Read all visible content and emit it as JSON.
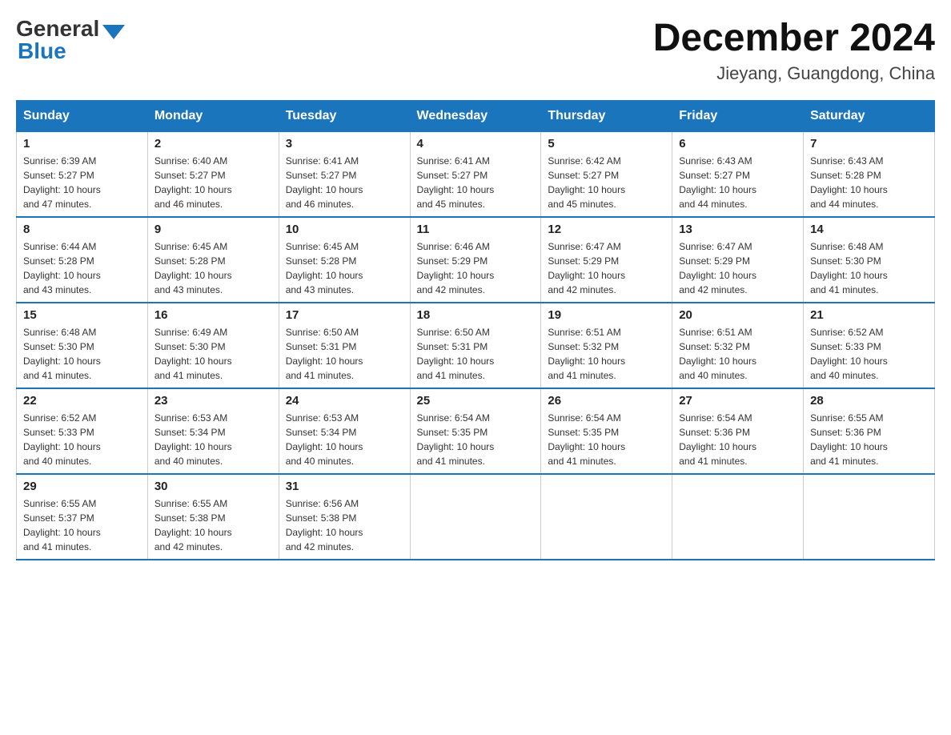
{
  "header": {
    "logo_general": "General",
    "logo_blue": "Blue",
    "month_year": "December 2024",
    "location": "Jieyang, Guangdong, China"
  },
  "days_of_week": [
    "Sunday",
    "Monday",
    "Tuesday",
    "Wednesday",
    "Thursday",
    "Friday",
    "Saturday"
  ],
  "weeks": [
    [
      {
        "day": "1",
        "sunrise": "6:39 AM",
        "sunset": "5:27 PM",
        "daylight": "10 hours and 47 minutes."
      },
      {
        "day": "2",
        "sunrise": "6:40 AM",
        "sunset": "5:27 PM",
        "daylight": "10 hours and 46 minutes."
      },
      {
        "day": "3",
        "sunrise": "6:41 AM",
        "sunset": "5:27 PM",
        "daylight": "10 hours and 46 minutes."
      },
      {
        "day": "4",
        "sunrise": "6:41 AM",
        "sunset": "5:27 PM",
        "daylight": "10 hours and 45 minutes."
      },
      {
        "day": "5",
        "sunrise": "6:42 AM",
        "sunset": "5:27 PM",
        "daylight": "10 hours and 45 minutes."
      },
      {
        "day": "6",
        "sunrise": "6:43 AM",
        "sunset": "5:27 PM",
        "daylight": "10 hours and 44 minutes."
      },
      {
        "day": "7",
        "sunrise": "6:43 AM",
        "sunset": "5:28 PM",
        "daylight": "10 hours and 44 minutes."
      }
    ],
    [
      {
        "day": "8",
        "sunrise": "6:44 AM",
        "sunset": "5:28 PM",
        "daylight": "10 hours and 43 minutes."
      },
      {
        "day": "9",
        "sunrise": "6:45 AM",
        "sunset": "5:28 PM",
        "daylight": "10 hours and 43 minutes."
      },
      {
        "day": "10",
        "sunrise": "6:45 AM",
        "sunset": "5:28 PM",
        "daylight": "10 hours and 43 minutes."
      },
      {
        "day": "11",
        "sunrise": "6:46 AM",
        "sunset": "5:29 PM",
        "daylight": "10 hours and 42 minutes."
      },
      {
        "day": "12",
        "sunrise": "6:47 AM",
        "sunset": "5:29 PM",
        "daylight": "10 hours and 42 minutes."
      },
      {
        "day": "13",
        "sunrise": "6:47 AM",
        "sunset": "5:29 PM",
        "daylight": "10 hours and 42 minutes."
      },
      {
        "day": "14",
        "sunrise": "6:48 AM",
        "sunset": "5:30 PM",
        "daylight": "10 hours and 41 minutes."
      }
    ],
    [
      {
        "day": "15",
        "sunrise": "6:48 AM",
        "sunset": "5:30 PM",
        "daylight": "10 hours and 41 minutes."
      },
      {
        "day": "16",
        "sunrise": "6:49 AM",
        "sunset": "5:30 PM",
        "daylight": "10 hours and 41 minutes."
      },
      {
        "day": "17",
        "sunrise": "6:50 AM",
        "sunset": "5:31 PM",
        "daylight": "10 hours and 41 minutes."
      },
      {
        "day": "18",
        "sunrise": "6:50 AM",
        "sunset": "5:31 PM",
        "daylight": "10 hours and 41 minutes."
      },
      {
        "day": "19",
        "sunrise": "6:51 AM",
        "sunset": "5:32 PM",
        "daylight": "10 hours and 41 minutes."
      },
      {
        "day": "20",
        "sunrise": "6:51 AM",
        "sunset": "5:32 PM",
        "daylight": "10 hours and 40 minutes."
      },
      {
        "day": "21",
        "sunrise": "6:52 AM",
        "sunset": "5:33 PM",
        "daylight": "10 hours and 40 minutes."
      }
    ],
    [
      {
        "day": "22",
        "sunrise": "6:52 AM",
        "sunset": "5:33 PM",
        "daylight": "10 hours and 40 minutes."
      },
      {
        "day": "23",
        "sunrise": "6:53 AM",
        "sunset": "5:34 PM",
        "daylight": "10 hours and 40 minutes."
      },
      {
        "day": "24",
        "sunrise": "6:53 AM",
        "sunset": "5:34 PM",
        "daylight": "10 hours and 40 minutes."
      },
      {
        "day": "25",
        "sunrise": "6:54 AM",
        "sunset": "5:35 PM",
        "daylight": "10 hours and 41 minutes."
      },
      {
        "day": "26",
        "sunrise": "6:54 AM",
        "sunset": "5:35 PM",
        "daylight": "10 hours and 41 minutes."
      },
      {
        "day": "27",
        "sunrise": "6:54 AM",
        "sunset": "5:36 PM",
        "daylight": "10 hours and 41 minutes."
      },
      {
        "day": "28",
        "sunrise": "6:55 AM",
        "sunset": "5:36 PM",
        "daylight": "10 hours and 41 minutes."
      }
    ],
    [
      {
        "day": "29",
        "sunrise": "6:55 AM",
        "sunset": "5:37 PM",
        "daylight": "10 hours and 41 minutes."
      },
      {
        "day": "30",
        "sunrise": "6:55 AM",
        "sunset": "5:38 PM",
        "daylight": "10 hours and 42 minutes."
      },
      {
        "day": "31",
        "sunrise": "6:56 AM",
        "sunset": "5:38 PM",
        "daylight": "10 hours and 42 minutes."
      },
      null,
      null,
      null,
      null
    ]
  ],
  "labels": {
    "sunrise": "Sunrise:",
    "sunset": "Sunset:",
    "daylight": "Daylight:"
  }
}
